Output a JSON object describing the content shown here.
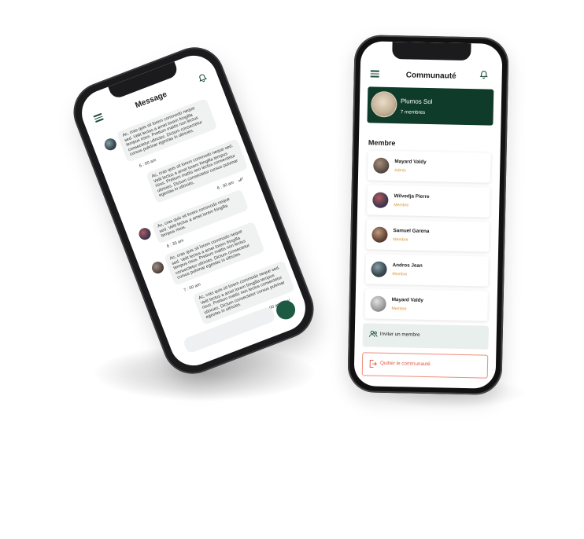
{
  "chat": {
    "title": "Message",
    "messages": [
      {
        "text": "Ac, cras quis sit lorem commodo neque sed. Velit lectus a amet lorem fringilla tempus risus. Pretium mattis non lectus consectetur ultricies. Dictum consectetur cursus pulvinar egestas in ultricies.",
        "time": "6 : 00 am"
      },
      {
        "text": "Ac, cras quis sit lorem commodo neque sed. Velit lectus a amet lorem fringilla tempus risus. Pretium mattis non lectus consectetur ultricies. Dictum consectetur cursus pulvinar egestas in ultricies.",
        "time": "6 : 30 am"
      },
      {
        "text": "Ac, cras quis sit lorem commodo neque sed. Velit lectus a amet lorem fringilla tempus risus.",
        "time": "6 : 35 am"
      },
      {
        "text": "Ac, cras quis sit lorem commodo neque sed. Velit lectus a amet lorem fringilla tempus risus. Pretium mattis non lectus consectetur ultricies. Dictum consectetur cursus pulvinar egestas in ultricies.",
        "time": "7 : 00 am"
      },
      {
        "text": "Ac, cras quis sit lorem commodo neque sed. Velit lectus a amet lorem fringilla tempus risus. Pretium mattis non lectus consectetur ultricies. Dictum consectetur cursus pulvinar egestas in ultricies.",
        "time": "8 : 00 am"
      }
    ]
  },
  "community": {
    "title": "Communauté",
    "group": {
      "name": "Plumos Sol",
      "count": "7 membres"
    },
    "section_title": "Membre",
    "members": [
      {
        "name": "Mayard Valdy",
        "role": "Admin"
      },
      {
        "name": "Wilvedja Pierre",
        "role": "Membre"
      },
      {
        "name": "Samuel Garena",
        "role": "Membre"
      },
      {
        "name": "Andros Jean",
        "role": "Membre"
      },
      {
        "name": "Mayard Valdy",
        "role": "Membre"
      }
    ],
    "invite_label": "Inviter un membre",
    "leave_label": "Quitter le communauté"
  },
  "colors": {
    "brand_green": "#0f3b2b",
    "accent_orange": "#d9922f",
    "danger": "#e05845"
  }
}
